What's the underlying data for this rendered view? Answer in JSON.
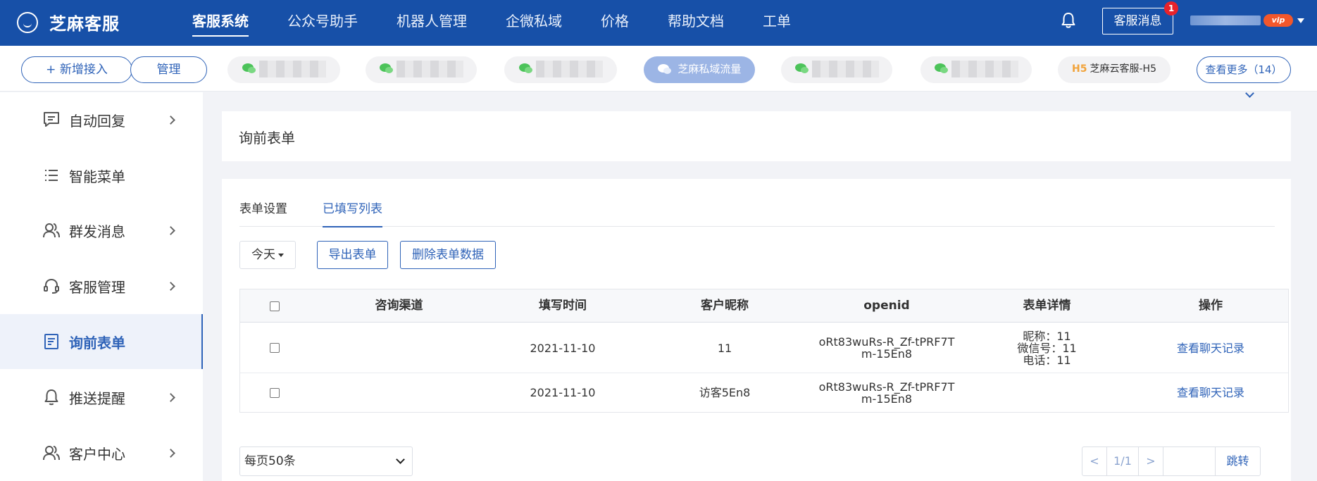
{
  "app": {
    "logo_text": "芝麻客服"
  },
  "topnav": {
    "items": [
      {
        "label": "客服系统"
      },
      {
        "label": "公众号助手"
      },
      {
        "label": "机器人管理"
      },
      {
        "label": "企微私域"
      },
      {
        "label": "价格"
      },
      {
        "label": "帮助文档"
      },
      {
        "label": "工单"
      }
    ],
    "message_btn": "客服消息",
    "message_badge": "1",
    "vip_label": "vip"
  },
  "channels": {
    "add_label": "+ 新增接入",
    "manage_label": "管理",
    "active_label": "芝麻私域流量",
    "h5_prefix": "H5",
    "h5_label": "芝麻云客服-H5",
    "more_label": "查看更多（14）"
  },
  "sidebar": {
    "items": [
      {
        "label": "自动回复"
      },
      {
        "label": "智能菜单"
      },
      {
        "label": "群发消息"
      },
      {
        "label": "客服管理"
      },
      {
        "label": "询前表单"
      },
      {
        "label": "推送提醒"
      },
      {
        "label": "客户中心"
      }
    ]
  },
  "page": {
    "title": "询前表单",
    "tabs": [
      {
        "label": "表单设置"
      },
      {
        "label": "已填写列表"
      }
    ],
    "date_filter": "今天",
    "export_btn": "导出表单",
    "delete_btn": "删除表单数据"
  },
  "table": {
    "headers": [
      "咨询渠道",
      "填写时间",
      "客户昵称",
      "openid",
      "表单详情",
      "操作"
    ],
    "rows": [
      {
        "channel": "",
        "time": "2021-11-10",
        "nickname": "11",
        "openid_1": "oRt83wuRs-R_Zf-tPRF7T",
        "openid_2": "m-15En8",
        "detail_1": "昵称：11",
        "detail_2": "微信号：11",
        "detail_3": "电话：11",
        "action": "查看聊天记录"
      },
      {
        "channel": "",
        "time": "2021-11-10",
        "nickname": "访客5En8",
        "openid_1": "oRt83wuRs-R_Zf-tPRF7T",
        "openid_2": "m-15En8",
        "detail_1": "",
        "detail_2": "",
        "detail_3": "",
        "action": "查看聊天记录"
      }
    ]
  },
  "pagination": {
    "per_page": "每页50条",
    "prev": "<",
    "page": "1/1",
    "next": ">",
    "jump_value": "",
    "jump_btn": "跳转"
  }
}
